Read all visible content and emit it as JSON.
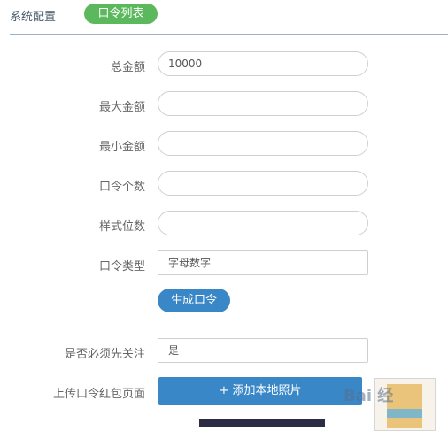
{
  "tabs": {
    "config": "系统配置",
    "list": "口令列表"
  },
  "form": {
    "total_label": "总金额",
    "total_value": "10000",
    "max_label": "最大金额",
    "max_value": "",
    "min_label": "最小金额",
    "min_value": "",
    "count_label": "口令个数",
    "count_value": "",
    "digits_label": "样式位数",
    "digits_value": "",
    "type_label": "口令类型",
    "type_value": "字母数字",
    "generate_button": "生成口令",
    "follow_label": "是否必须先关注",
    "follow_value": "是",
    "upload_label": "上传口令红包页面",
    "upload_button": "+ 添加本地照片"
  },
  "watermark": "Bai 经"
}
